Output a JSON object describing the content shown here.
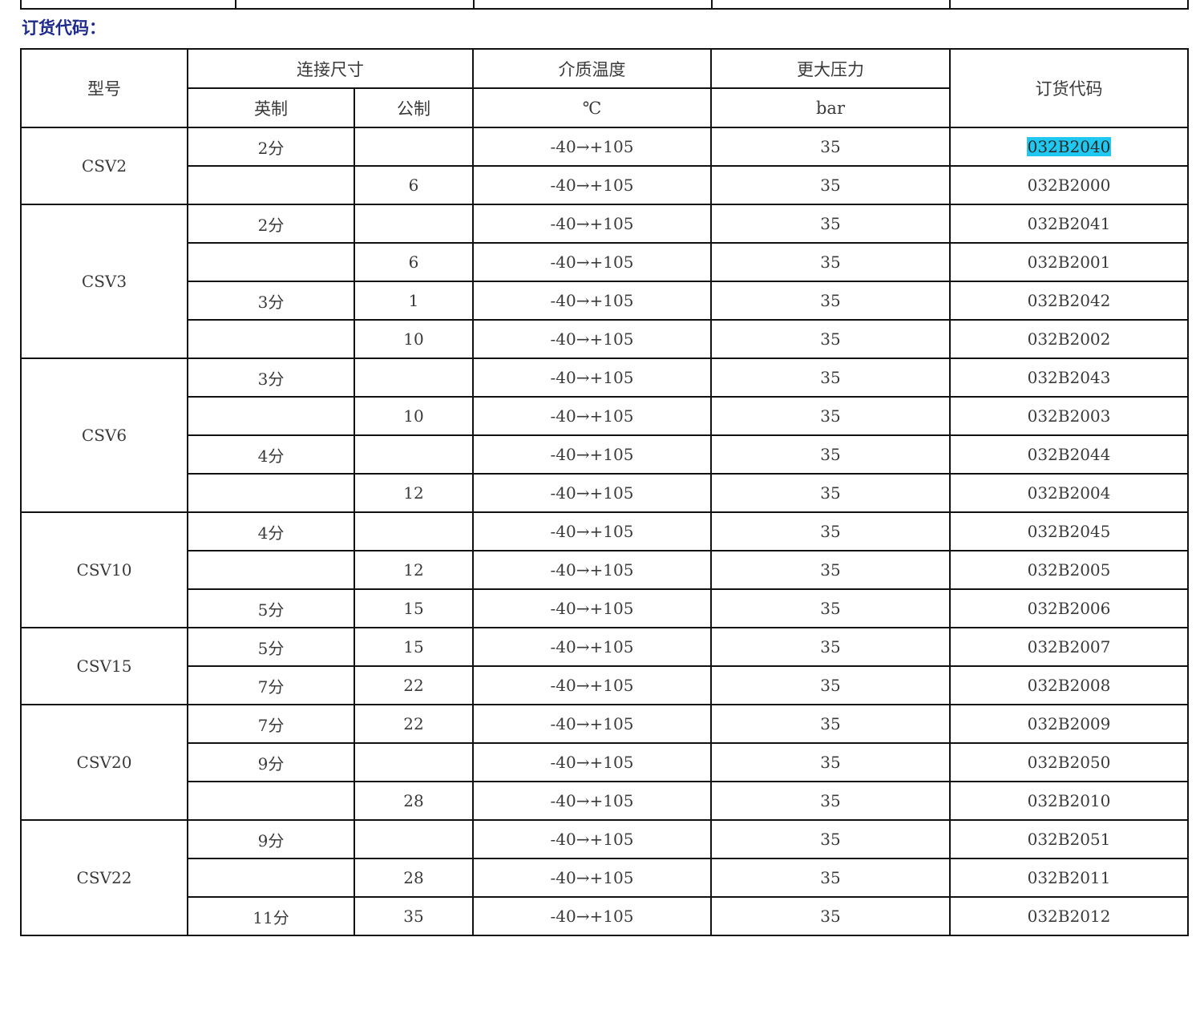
{
  "section_title": "订货代码：",
  "headers": {
    "model": "型号",
    "connection_size": "连接尺寸",
    "imperial": "英制",
    "metric": "公制",
    "media_temp": "介质温度",
    "temp_unit": "℃",
    "max_pressure": "更大压力",
    "pressure_unit": "bar",
    "order_code": "订货代码"
  },
  "groups": [
    {
      "model": "CSV2",
      "rows": [
        {
          "imperial": "2分",
          "metric": "",
          "temp": "-40→+105",
          "pressure": "35",
          "code": "032B2040",
          "highlight": true
        },
        {
          "imperial": "",
          "metric": "6",
          "temp": "-40→+105",
          "pressure": "35",
          "code": "032B2000"
        }
      ]
    },
    {
      "model": "CSV3",
      "rows": [
        {
          "imperial": "2分",
          "metric": "",
          "temp": "-40→+105",
          "pressure": "35",
          "code": "032B2041"
        },
        {
          "imperial": "",
          "metric": "6",
          "temp": "-40→+105",
          "pressure": "35",
          "code": "032B2001"
        },
        {
          "imperial": "3分",
          "metric": "1",
          "temp": "-40→+105",
          "pressure": "35",
          "code": "032B2042"
        },
        {
          "imperial": "",
          "metric": "10",
          "temp": "-40→+105",
          "pressure": "35",
          "code": "032B2002"
        }
      ]
    },
    {
      "model": "CSV6",
      "rows": [
        {
          "imperial": "3分",
          "metric": "",
          "temp": "-40→+105",
          "pressure": "35",
          "code": "032B2043"
        },
        {
          "imperial": "",
          "metric": "10",
          "temp": "-40→+105",
          "pressure": "35",
          "code": "032B2003"
        },
        {
          "imperial": "4分",
          "metric": "",
          "temp": "-40→+105",
          "pressure": "35",
          "code": "032B2044"
        },
        {
          "imperial": "",
          "metric": "12",
          "temp": "-40→+105",
          "pressure": "35",
          "code": "032B2004"
        }
      ]
    },
    {
      "model": "CSV10",
      "rows": [
        {
          "imperial": "4分",
          "metric": "",
          "temp": "-40→+105",
          "pressure": "35",
          "code": "032B2045"
        },
        {
          "imperial": "",
          "metric": "12",
          "temp": "-40→+105",
          "pressure": "35",
          "code": "032B2005"
        },
        {
          "imperial": "5分",
          "metric": "15",
          "temp": "-40→+105",
          "pressure": "35",
          "code": "032B2006"
        }
      ]
    },
    {
      "model": "CSV15",
      "rows": [
        {
          "imperial": "5分",
          "metric": "15",
          "temp": "-40→+105",
          "pressure": "35",
          "code": "032B2007"
        },
        {
          "imperial": "7分",
          "metric": "22",
          "temp": "-40→+105",
          "pressure": "35",
          "code": "032B2008"
        }
      ]
    },
    {
      "model": "CSV20",
      "rows": [
        {
          "imperial": "7分",
          "metric": "22",
          "temp": "-40→+105",
          "pressure": "35",
          "code": "032B2009"
        },
        {
          "imperial": "9分",
          "metric": "",
          "temp": "-40→+105",
          "pressure": "35",
          "code": "032B2050"
        },
        {
          "imperial": "",
          "metric": "28",
          "temp": "-40→+105",
          "pressure": "35",
          "code": "032B2010"
        }
      ]
    },
    {
      "model": "CSV22",
      "rows": [
        {
          "imperial": "9分",
          "metric": "",
          "temp": "-40→+105",
          "pressure": "35",
          "code": "032B2051"
        },
        {
          "imperial": "",
          "metric": "28",
          "temp": "-40→+105",
          "pressure": "35",
          "code": "032B2011"
        },
        {
          "imperial": "11分",
          "metric": "35",
          "temp": "-40→+105",
          "pressure": "35",
          "code": "032B2012"
        }
      ]
    }
  ],
  "colors": {
    "title": "#1e2a8c",
    "highlight": "#1fc8f0",
    "border": "#111111",
    "text": "#3a3a3a"
  }
}
